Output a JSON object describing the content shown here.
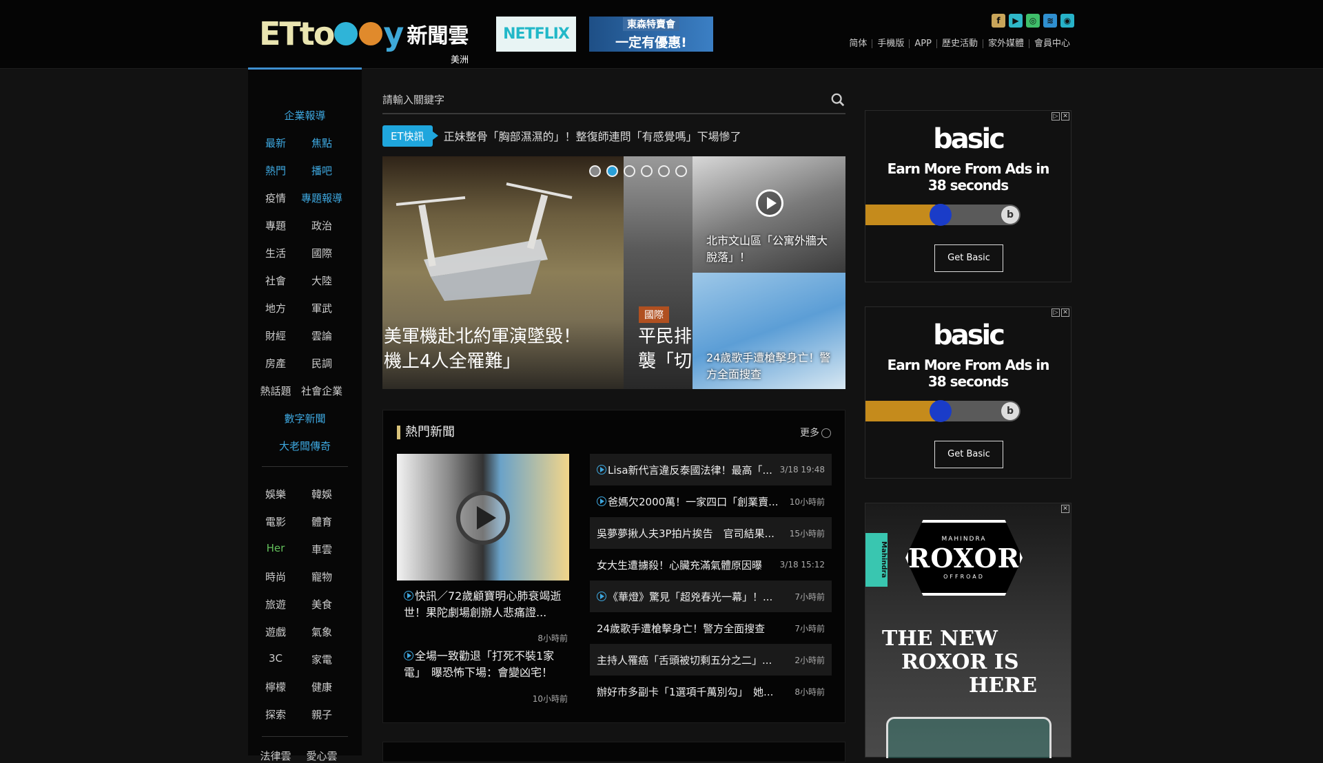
{
  "header": {
    "logo_prefix": "ETto",
    "logo_suffix": "y",
    "logo_cn": "新聞雲",
    "region": "美洲",
    "netflix_ad": "NETFLIX",
    "promo_line1": "東森特賣會",
    "promo_line2": "一定有優惠!",
    "social_icons": [
      "facebook-icon",
      "youtube-icon",
      "instagram-icon",
      "rss-icon",
      "weibo-icon"
    ],
    "social_colors": [
      "#c9a55a",
      "#2fb7c8",
      "#3fbf6a",
      "#2f8fd0",
      "#27b2c8"
    ],
    "links": [
      "简体",
      "手機版",
      "APP",
      "歷史活動",
      "家外媒體",
      "會員中心"
    ]
  },
  "sidebar": {
    "items": [
      {
        "label": "企業報導",
        "color": "blue"
      },
      {
        "label": "最新",
        "color": "blue"
      },
      {
        "label": "焦點",
        "color": "blue"
      },
      {
        "label": "熱門",
        "color": "blue"
      },
      {
        "label": "播吧",
        "color": "blue"
      },
      {
        "label": "疫情",
        "color": "plain"
      },
      {
        "label": "專題報導",
        "color": "blue"
      },
      {
        "label": "專題",
        "color": "plain"
      },
      {
        "label": "政治",
        "color": "plain"
      },
      {
        "label": "生活",
        "color": "plain"
      },
      {
        "label": "國際",
        "color": "plain"
      },
      {
        "label": "社會",
        "color": "plain"
      },
      {
        "label": "大陸",
        "color": "plain"
      },
      {
        "label": "地方",
        "color": "plain"
      },
      {
        "label": "軍武",
        "color": "plain"
      },
      {
        "label": "財經",
        "color": "plain"
      },
      {
        "label": "雲論",
        "color": "plain"
      },
      {
        "label": "房產",
        "color": "plain"
      },
      {
        "label": "民調",
        "color": "plain"
      },
      {
        "label": "熱話題",
        "color": "plain"
      },
      {
        "label": "社會企業",
        "color": "plain"
      },
      {
        "label": "數字新聞",
        "color": "blue"
      },
      {
        "label": "大老闆傳奇",
        "color": "blue"
      },
      {
        "label": "娛樂",
        "color": "plain"
      },
      {
        "label": "韓娛",
        "color": "plain"
      },
      {
        "label": "電影",
        "color": "plain"
      },
      {
        "label": "體育",
        "color": "plain"
      },
      {
        "label": "Her",
        "color": "green"
      },
      {
        "label": "車雲",
        "color": "plain"
      },
      {
        "label": "時尚",
        "color": "plain"
      },
      {
        "label": "寵物",
        "color": "plain"
      },
      {
        "label": "旅遊",
        "color": "plain"
      },
      {
        "label": "美食",
        "color": "plain"
      },
      {
        "label": "遊戲",
        "color": "plain"
      },
      {
        "label": "氣象",
        "color": "plain"
      },
      {
        "label": "3C",
        "color": "plain"
      },
      {
        "label": "家電",
        "color": "plain"
      },
      {
        "label": "檸檬",
        "color": "plain"
      },
      {
        "label": "健康",
        "color": "plain"
      },
      {
        "label": "探索",
        "color": "plain"
      },
      {
        "label": "親子",
        "color": "plain"
      },
      {
        "label": "法律雲",
        "color": "plain"
      },
      {
        "label": "愛心雲",
        "color": "plain"
      }
    ]
  },
  "search": {
    "placeholder": "請輸入關鍵字"
  },
  "breaking": {
    "tag": "ET快訊",
    "text": "正妹整骨「胸部濕濕的」！整復師連問「有感覺嗎」下場慘了"
  },
  "carousel": {
    "main_title_line1": "美軍機赴北約軍演墜毀！",
    "main_title_line2": "機上4人全罹難」",
    "second_category": "國際",
    "second_title_line1": "平民排",
    "second_title_line2": "襲「切",
    "dot_count": 6,
    "active_dot": 1,
    "thumb1_title": "北市文山區「公寓外牆大脫落」！",
    "thumb2_title": "24歲歌手遭槍擊身亡！警方全面搜查"
  },
  "hot_news": {
    "title": "熱門新聞",
    "more": "更多",
    "left_items": [
      {
        "title": "快訊／72歲顧寶明心肺衰竭逝世！果陀劇場創辦人悲痛證...",
        "time": "8小時前",
        "video": true
      },
      {
        "title": "全場一致勸退「打死不裝1家電」　曝恐怖下場：會變凶宅！",
        "time": "10小時前",
        "video": true
      }
    ],
    "right_items": [
      {
        "title": "Lisa新代言違反泰國法律！最高「...",
        "time": "3/18 19:48",
        "video": true
      },
      {
        "title": "爸媽欠2000萬！一家四口「創業賣...",
        "time": "10小時前",
        "video": true
      },
      {
        "title": "吳夢夢揪人夫3P拍片挨告　官司結果...",
        "time": "15小時前",
        "video": false
      },
      {
        "title": "女大生遭擄殺！心臟充滿氣體原因曝",
        "time": "3/18 15:12",
        "video": false
      },
      {
        "title": "《華燈》驚見「超兇春光一幕」！...",
        "time": "7小時前",
        "video": true
      },
      {
        "title": "24歲歌手遭槍擊身亡！警方全面搜查",
        "time": "7小時前",
        "video": false
      },
      {
        "title": "主持人罹癌「舌頭被切剩五分之二」...",
        "time": "2小時前",
        "video": false
      },
      {
        "title": "辦好市多副卡「1選項千萬別勾」　她...",
        "time": "8小時前",
        "video": false
      }
    ]
  },
  "ads": {
    "basic": {
      "logo": "basic",
      "line1": "Earn More From Ads in",
      "line2": "38 seconds",
      "button": "Get Basic",
      "progress": 0.45
    },
    "roxor": {
      "brand": "Mahindra",
      "badge_top": "MAHINDRA",
      "badge": "ROXOR",
      "badge_bottom": "OFFROAD",
      "line1": "THE NEW",
      "line2": "ROXOR IS",
      "line3": "HERE"
    }
  }
}
